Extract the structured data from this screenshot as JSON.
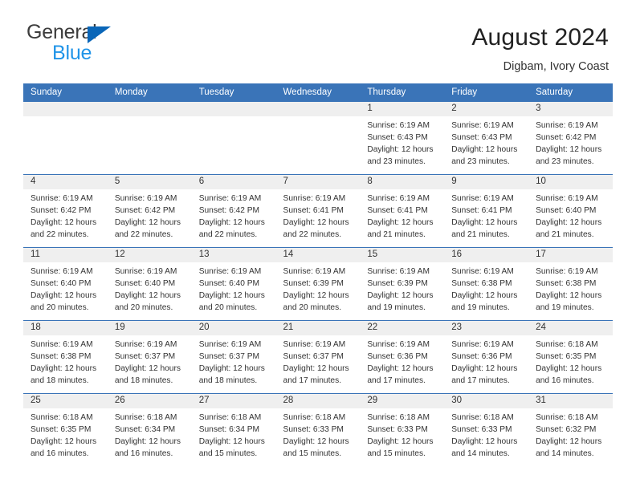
{
  "logo": {
    "primary_text": "General",
    "secondary_text": "Blue",
    "primary_color": "#3c3c3c",
    "secondary_color": "#2094e8",
    "triangle_color": "#0a66b8"
  },
  "header": {
    "title": "August 2024",
    "subtitle": "Digbam, Ivory Coast"
  },
  "theme": {
    "header_bg": "#3a74b8",
    "header_text": "#ffffff",
    "daynum_strip_bg": "#efefef",
    "cell_bg": "#ffffff",
    "text": "#333333"
  },
  "calendar": {
    "weekday_headers": [
      "Sunday",
      "Monday",
      "Tuesday",
      "Wednesday",
      "Thursday",
      "Friday",
      "Saturday"
    ],
    "weeks": [
      [
        {
          "day": "",
          "empty": true
        },
        {
          "day": "",
          "empty": true
        },
        {
          "day": "",
          "empty": true
        },
        {
          "day": "",
          "empty": true
        },
        {
          "day": "1",
          "sunrise": "Sunrise: 6:19 AM",
          "sunset": "Sunset: 6:43 PM",
          "daylight": "Daylight: 12 hours and 23 minutes."
        },
        {
          "day": "2",
          "sunrise": "Sunrise: 6:19 AM",
          "sunset": "Sunset: 6:43 PM",
          "daylight": "Daylight: 12 hours and 23 minutes."
        },
        {
          "day": "3",
          "sunrise": "Sunrise: 6:19 AM",
          "sunset": "Sunset: 6:42 PM",
          "daylight": "Daylight: 12 hours and 23 minutes."
        }
      ],
      [
        {
          "day": "4",
          "sunrise": "Sunrise: 6:19 AM",
          "sunset": "Sunset: 6:42 PM",
          "daylight": "Daylight: 12 hours and 22 minutes."
        },
        {
          "day": "5",
          "sunrise": "Sunrise: 6:19 AM",
          "sunset": "Sunset: 6:42 PM",
          "daylight": "Daylight: 12 hours and 22 minutes."
        },
        {
          "day": "6",
          "sunrise": "Sunrise: 6:19 AM",
          "sunset": "Sunset: 6:42 PM",
          "daylight": "Daylight: 12 hours and 22 minutes."
        },
        {
          "day": "7",
          "sunrise": "Sunrise: 6:19 AM",
          "sunset": "Sunset: 6:41 PM",
          "daylight": "Daylight: 12 hours and 22 minutes."
        },
        {
          "day": "8",
          "sunrise": "Sunrise: 6:19 AM",
          "sunset": "Sunset: 6:41 PM",
          "daylight": "Daylight: 12 hours and 21 minutes."
        },
        {
          "day": "9",
          "sunrise": "Sunrise: 6:19 AM",
          "sunset": "Sunset: 6:41 PM",
          "daylight": "Daylight: 12 hours and 21 minutes."
        },
        {
          "day": "10",
          "sunrise": "Sunrise: 6:19 AM",
          "sunset": "Sunset: 6:40 PM",
          "daylight": "Daylight: 12 hours and 21 minutes."
        }
      ],
      [
        {
          "day": "11",
          "sunrise": "Sunrise: 6:19 AM",
          "sunset": "Sunset: 6:40 PM",
          "daylight": "Daylight: 12 hours and 20 minutes."
        },
        {
          "day": "12",
          "sunrise": "Sunrise: 6:19 AM",
          "sunset": "Sunset: 6:40 PM",
          "daylight": "Daylight: 12 hours and 20 minutes."
        },
        {
          "day": "13",
          "sunrise": "Sunrise: 6:19 AM",
          "sunset": "Sunset: 6:40 PM",
          "daylight": "Daylight: 12 hours and 20 minutes."
        },
        {
          "day": "14",
          "sunrise": "Sunrise: 6:19 AM",
          "sunset": "Sunset: 6:39 PM",
          "daylight": "Daylight: 12 hours and 20 minutes."
        },
        {
          "day": "15",
          "sunrise": "Sunrise: 6:19 AM",
          "sunset": "Sunset: 6:39 PM",
          "daylight": "Daylight: 12 hours and 19 minutes."
        },
        {
          "day": "16",
          "sunrise": "Sunrise: 6:19 AM",
          "sunset": "Sunset: 6:38 PM",
          "daylight": "Daylight: 12 hours and 19 minutes."
        },
        {
          "day": "17",
          "sunrise": "Sunrise: 6:19 AM",
          "sunset": "Sunset: 6:38 PM",
          "daylight": "Daylight: 12 hours and 19 minutes."
        }
      ],
      [
        {
          "day": "18",
          "sunrise": "Sunrise: 6:19 AM",
          "sunset": "Sunset: 6:38 PM",
          "daylight": "Daylight: 12 hours and 18 minutes."
        },
        {
          "day": "19",
          "sunrise": "Sunrise: 6:19 AM",
          "sunset": "Sunset: 6:37 PM",
          "daylight": "Daylight: 12 hours and 18 minutes."
        },
        {
          "day": "20",
          "sunrise": "Sunrise: 6:19 AM",
          "sunset": "Sunset: 6:37 PM",
          "daylight": "Daylight: 12 hours and 18 minutes."
        },
        {
          "day": "21",
          "sunrise": "Sunrise: 6:19 AM",
          "sunset": "Sunset: 6:37 PM",
          "daylight": "Daylight: 12 hours and 17 minutes."
        },
        {
          "day": "22",
          "sunrise": "Sunrise: 6:19 AM",
          "sunset": "Sunset: 6:36 PM",
          "daylight": "Daylight: 12 hours and 17 minutes."
        },
        {
          "day": "23",
          "sunrise": "Sunrise: 6:19 AM",
          "sunset": "Sunset: 6:36 PM",
          "daylight": "Daylight: 12 hours and 17 minutes."
        },
        {
          "day": "24",
          "sunrise": "Sunrise: 6:18 AM",
          "sunset": "Sunset: 6:35 PM",
          "daylight": "Daylight: 12 hours and 16 minutes."
        }
      ],
      [
        {
          "day": "25",
          "sunrise": "Sunrise: 6:18 AM",
          "sunset": "Sunset: 6:35 PM",
          "daylight": "Daylight: 12 hours and 16 minutes."
        },
        {
          "day": "26",
          "sunrise": "Sunrise: 6:18 AM",
          "sunset": "Sunset: 6:34 PM",
          "daylight": "Daylight: 12 hours and 16 minutes."
        },
        {
          "day": "27",
          "sunrise": "Sunrise: 6:18 AM",
          "sunset": "Sunset: 6:34 PM",
          "daylight": "Daylight: 12 hours and 15 minutes."
        },
        {
          "day": "28",
          "sunrise": "Sunrise: 6:18 AM",
          "sunset": "Sunset: 6:33 PM",
          "daylight": "Daylight: 12 hours and 15 minutes."
        },
        {
          "day": "29",
          "sunrise": "Sunrise: 6:18 AM",
          "sunset": "Sunset: 6:33 PM",
          "daylight": "Daylight: 12 hours and 15 minutes."
        },
        {
          "day": "30",
          "sunrise": "Sunrise: 6:18 AM",
          "sunset": "Sunset: 6:33 PM",
          "daylight": "Daylight: 12 hours and 14 minutes."
        },
        {
          "day": "31",
          "sunrise": "Sunrise: 6:18 AM",
          "sunset": "Sunset: 6:32 PM",
          "daylight": "Daylight: 12 hours and 14 minutes."
        }
      ]
    ]
  }
}
